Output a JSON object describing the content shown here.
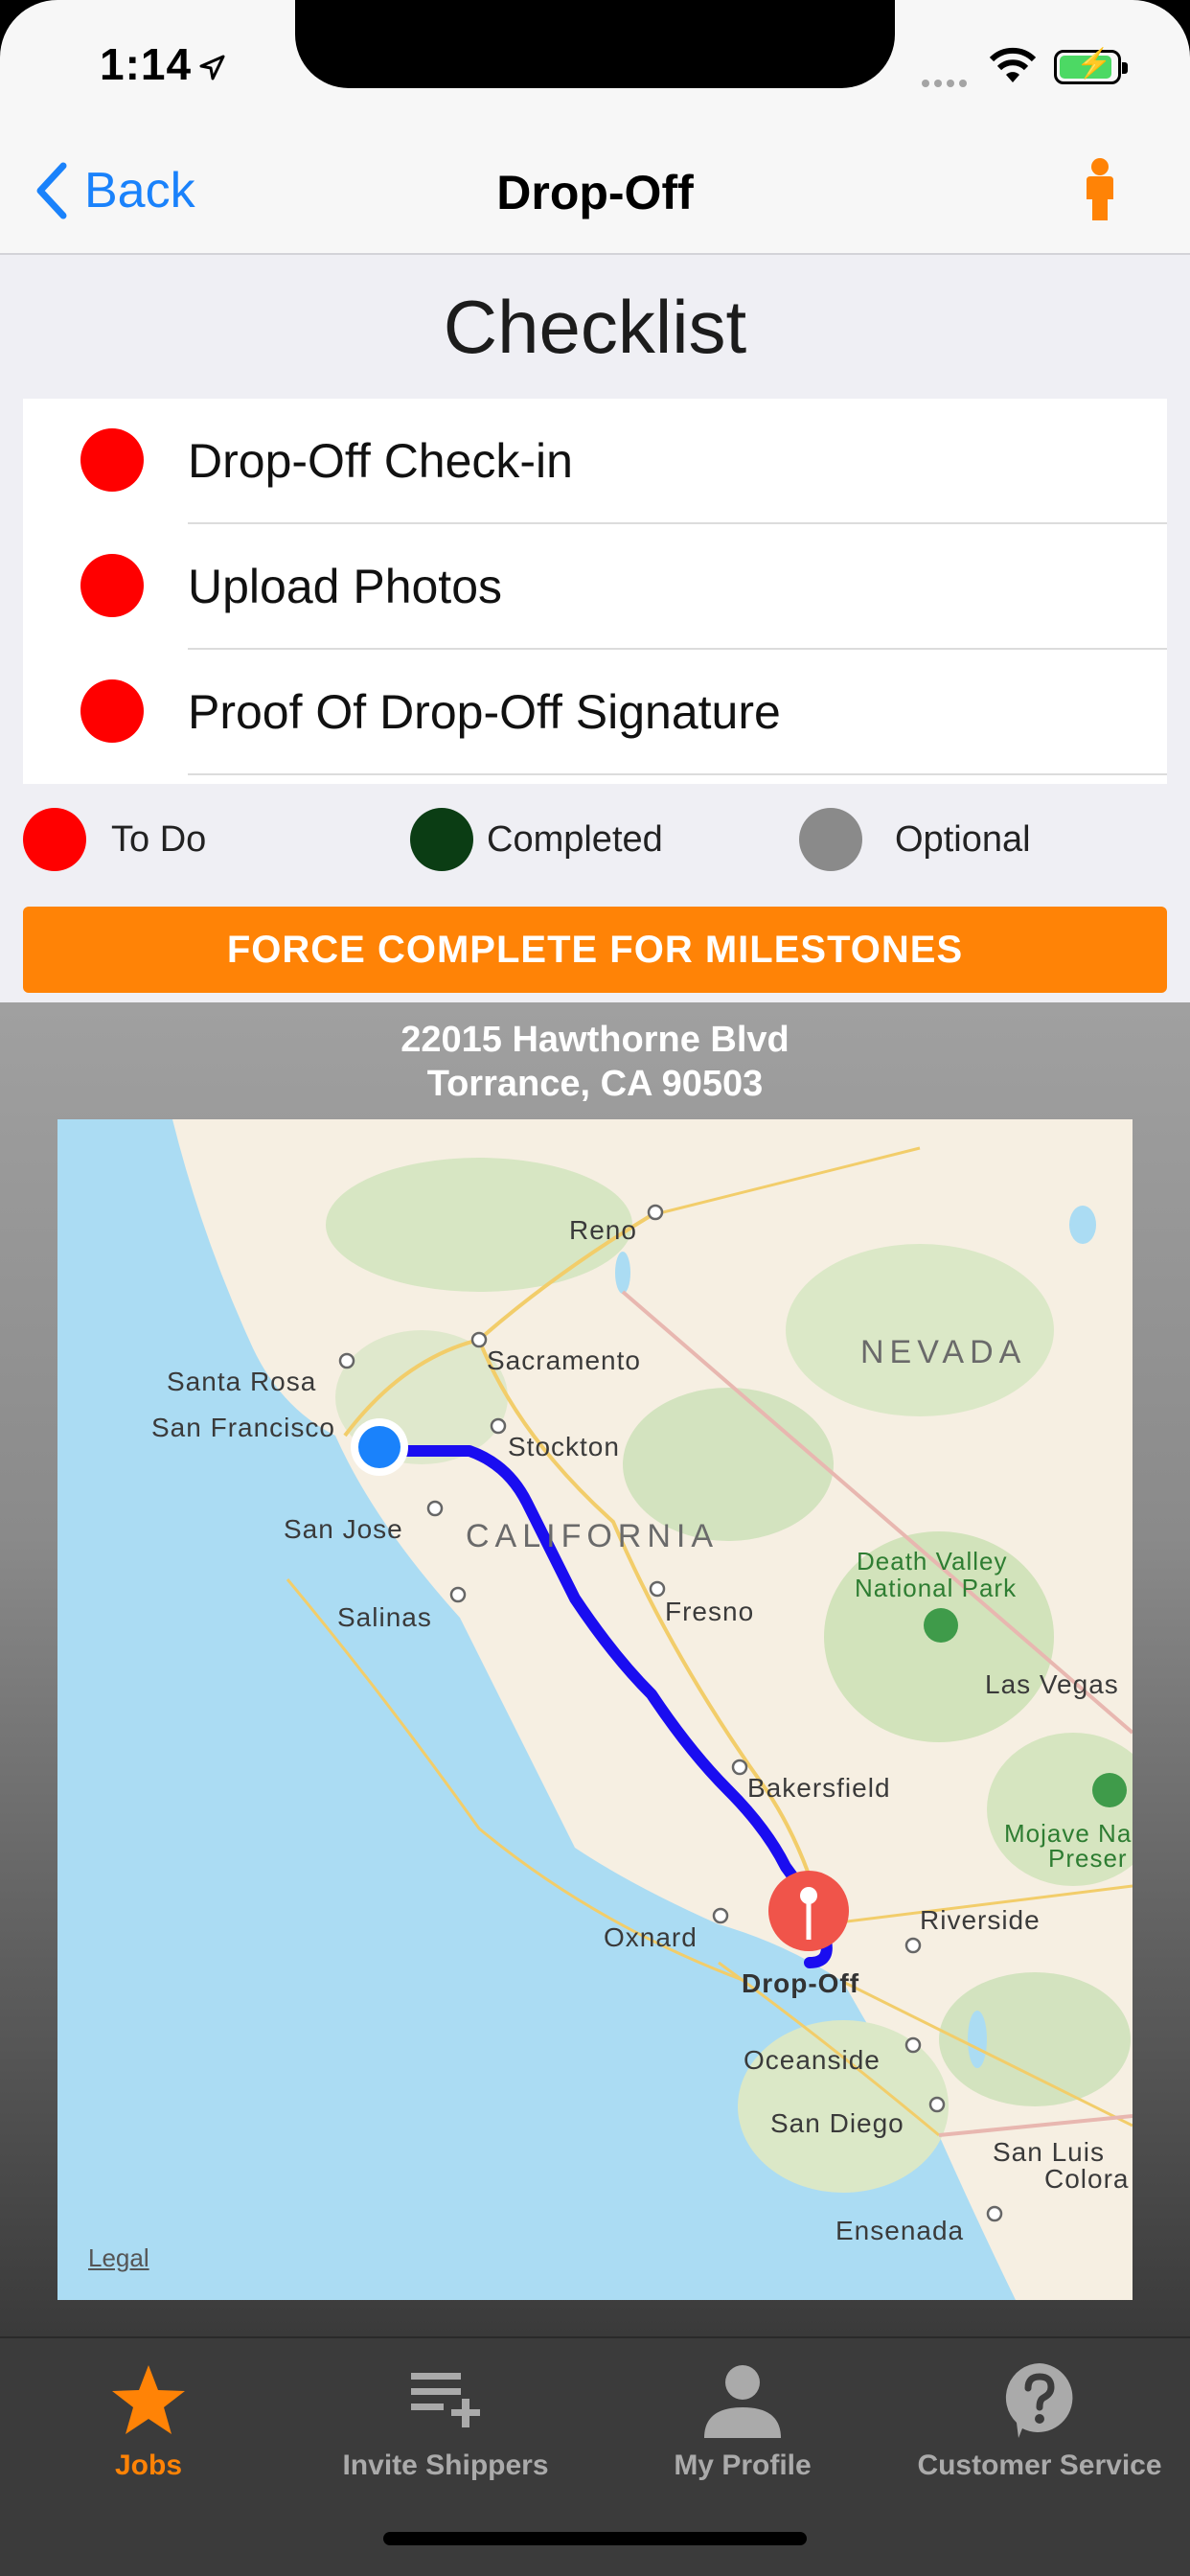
{
  "status_bar": {
    "time": "1:14"
  },
  "nav": {
    "back_label": "Back",
    "title": "Drop-Off"
  },
  "checklist": {
    "title": "Checklist",
    "items": [
      {
        "label": "Drop-Off Check-in",
        "status": "todo"
      },
      {
        "label": "Upload Photos",
        "status": "todo"
      },
      {
        "label": "Proof Of Drop-Off Signature",
        "status": "todo"
      }
    ]
  },
  "legend": [
    {
      "label": "To Do",
      "color": "#ff0000"
    },
    {
      "label": "Completed",
      "color": "#0b3d14"
    },
    {
      "label": "Optional",
      "color": "#8a8a8a"
    }
  ],
  "force_button": {
    "label": "FORCE COMPLETE FOR MILESTONES",
    "color": "#ff8306"
  },
  "address": {
    "line1": "22015 Hawthorne Blvd",
    "line2": "Torrance, CA 90503"
  },
  "map": {
    "labels": {
      "reno": "Reno",
      "sacramento": "Sacramento",
      "nevada": "NEVADA",
      "santa_rosa": "Santa Rosa",
      "san_francisco": "San Francisco",
      "stockton": "Stockton",
      "san_jose": "San Jose",
      "california": "CALIFORNIA",
      "death_valley": "Death Valley",
      "national_park": "National Park",
      "fresno": "Fresno",
      "salinas": "Salinas",
      "las_vegas": "Las Vegas",
      "bakersfield": "Bakersfield",
      "mojave": "Mojave Na",
      "preserve": "Preser",
      "oxnard": "Oxnard",
      "riverside": "Riverside",
      "drop_off": "Drop-Off",
      "oceanside": "Oceanside",
      "san_diego": "San Diego",
      "san_luis": "San Luis",
      "colorado": "Colora",
      "ensenada": "Ensenada"
    },
    "legal": "Legal",
    "route_color": "#1a0df0"
  },
  "tabs": [
    {
      "label": "Jobs",
      "icon": "star-icon",
      "active": true
    },
    {
      "label": "Invite Shippers",
      "icon": "add-list-icon",
      "active": false
    },
    {
      "label": "My Profile",
      "icon": "person-icon",
      "active": false
    },
    {
      "label": "Customer Service",
      "icon": "help-icon",
      "active": false
    }
  ]
}
